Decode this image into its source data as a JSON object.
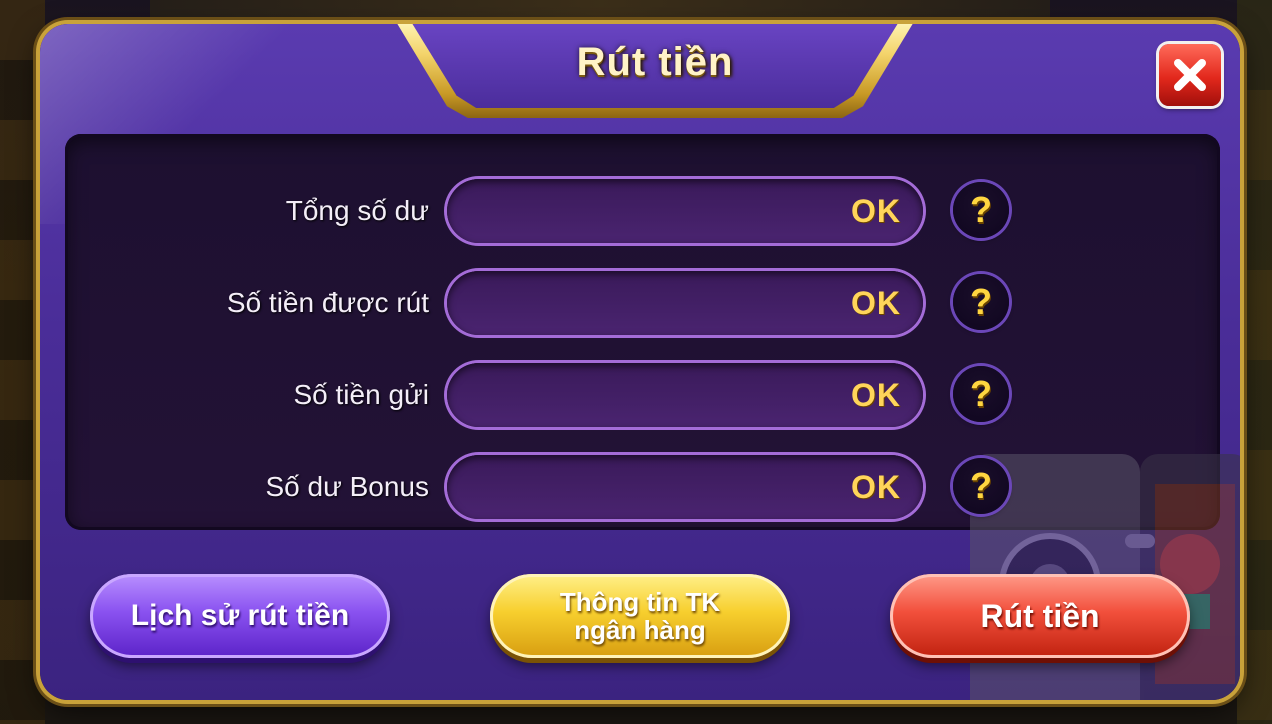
{
  "dialog": {
    "title": "Rút tiền",
    "close_icon": "close-x-icon"
  },
  "rows": [
    {
      "label": "Tổng số dư",
      "value": "OK",
      "help": "?"
    },
    {
      "label": "Số tiền được rút",
      "value": "OK",
      "help": "?"
    },
    {
      "label": "Số tiền gửi",
      "value": "OK",
      "help": "?"
    },
    {
      "label": "Số dư Bonus",
      "value": "OK",
      "help": "?"
    }
  ],
  "buttons": {
    "history": "Lịch sử rút tiền",
    "bank_line1": "Thông tin TK",
    "bank_line2": "ngân hàng",
    "withdraw": "Rút tiền"
  },
  "colors": {
    "dialog_purple": "#4a2d98",
    "gold_border": "#c9a23a",
    "value_yellow": "#ffd55a",
    "help_yellow": "#ffd640",
    "history_button": "#8a52f0",
    "bank_button": "#f7cf2e",
    "withdraw_button": "#f2503c",
    "close_red": "#e2281c"
  }
}
